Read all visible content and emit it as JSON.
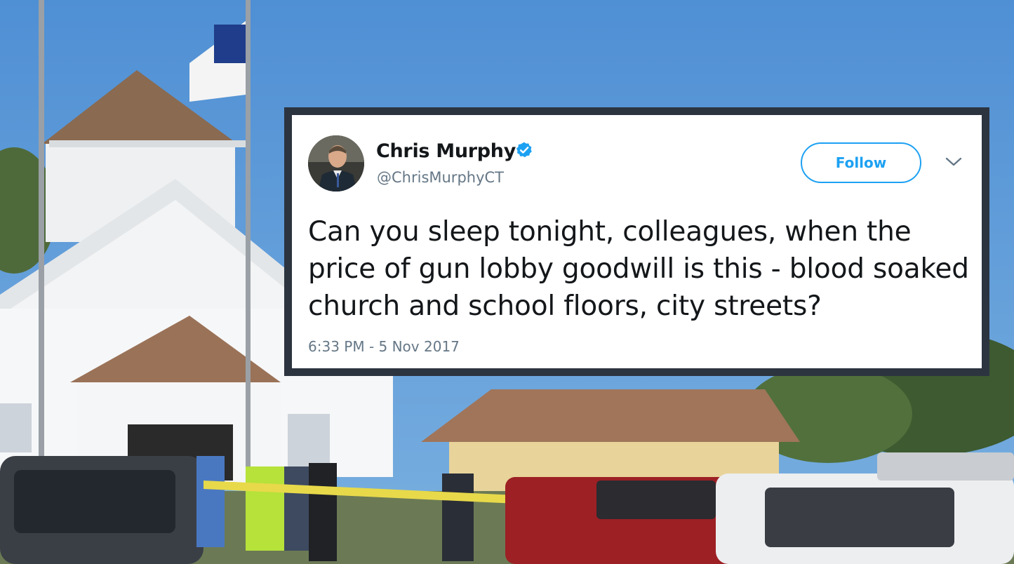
{
  "tweet": {
    "author_name": "Chris Murphy",
    "handle": "@ChrisMurphyCT",
    "verified_icon": "verified-badge-icon",
    "follow_label": "Follow",
    "menu_icon": "chevron-down-icon",
    "text": "Can you sleep tonight, colleagues, when the price of gun lobby goodwill is this - blood soaked church and school floors, city streets?",
    "timestamp": "6:33 PM - 5 Nov 2017"
  },
  "colors": {
    "accent": "#1da1f2",
    "frame": "#2c3440",
    "text": "#14171a",
    "muted": "#657786",
    "sky": "#5f97d3"
  }
}
